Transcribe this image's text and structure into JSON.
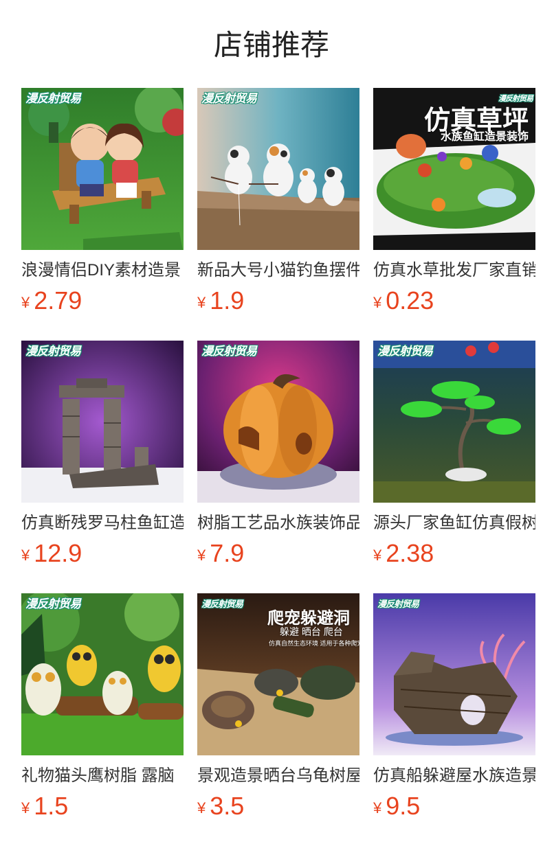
{
  "page_title": "店铺推荐",
  "currency": "¥",
  "watermark": "漫反射贸易",
  "colors": {
    "price": "#e8431e",
    "text": "#333333"
  },
  "products": [
    {
      "name": "浪漫情侣DIY素材造景",
      "price": "2.79",
      "image": "couple-on-bench-image"
    },
    {
      "name": "新品大号小猫钓鱼摆件",
      "price": "1.9",
      "image": "fishing-cats-image"
    },
    {
      "name": "仿真水草批发厂家直销",
      "price": "0.23",
      "image": "artificial-lawn-image",
      "overlay_title": "仿真草坪",
      "overlay_sub": "水族鱼缸造景装饰"
    },
    {
      "name": "仿真断残罗马柱鱼缸造",
      "price": "12.9",
      "image": "roman-column-ruin-image"
    },
    {
      "name": "树脂工艺品水族装饰品",
      "price": "7.9",
      "image": "pumpkin-house-image"
    },
    {
      "name": "源头厂家鱼缸仿真假树",
      "price": "2.38",
      "image": "bonsai-tree-image"
    },
    {
      "name": "礼物猫头鹰树脂 露脑",
      "price": "1.5",
      "image": "owl-figures-image"
    },
    {
      "name": "景观造景晒台乌龟树屋",
      "price": "3.5",
      "image": "reptile-hideout-image",
      "overlay_title": "爬宠躲避洞",
      "overlay_sub": "躲避  晒台  爬台",
      "overlay_small": "仿真自然生态环境 适用于各种爬宠"
    },
    {
      "name": "仿真船躲避屋水族造景",
      "price": "9.5",
      "image": "shipwreck-image"
    }
  ]
}
